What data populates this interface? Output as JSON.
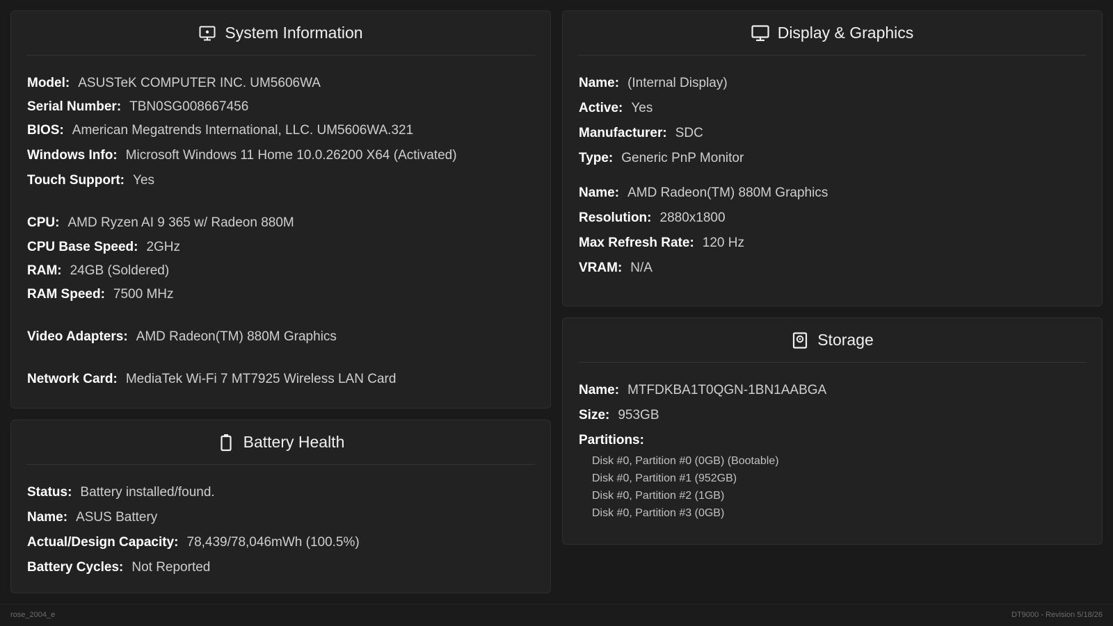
{
  "system": {
    "title": "System Information",
    "icon": "monitor-dot-icon",
    "rows": [
      {
        "key": "Model:",
        "value": "ASUSTeK COMPUTER INC. UM5606WA"
      },
      {
        "key": "Serial Number:",
        "value": "TBN0SG008667456"
      },
      {
        "key": "BIOS:",
        "value": "American Megatrends International, LLC. UM5606WA.321"
      },
      {
        "key": "Windows Info:",
        "value": "Microsoft Windows 11 Home 10.0.26200 X64 (Activated)"
      },
      {
        "key": "Touch Support:",
        "value": "Yes"
      },
      {
        "key": "CPU:",
        "value": "AMD Ryzen AI 9 365 w/ Radeon 880M"
      },
      {
        "key": "CPU Base Speed:",
        "value": "2GHz"
      },
      {
        "key": "RAM:",
        "value": "24GB (Soldered)"
      },
      {
        "key": "RAM Speed:",
        "value": "7500 MHz"
      },
      {
        "key": "Video Adapters:",
        "value": "AMD Radeon(TM) 880M Graphics"
      },
      {
        "key": "Network Card:",
        "value": "MediaTek Wi-Fi 7 MT7925 Wireless LAN Card"
      }
    ]
  },
  "battery": {
    "title": "Battery Health",
    "icon": "battery-icon",
    "rows": [
      {
        "key": "Status:",
        "value": "Battery installed/found."
      },
      {
        "key": "Name:",
        "value": "ASUS Battery"
      },
      {
        "key": "Actual/Design Capacity:",
        "value": "78,439/78,046mWh (100.5%)"
      },
      {
        "key": "Battery Cycles:",
        "value": "Not Reported"
      }
    ]
  },
  "display": {
    "title": "Display & Graphics",
    "icon": "monitor-icon",
    "rows": [
      {
        "key": "Name:",
        "value": "(Internal Display)"
      },
      {
        "key": "Active:",
        "value": "Yes"
      },
      {
        "key": "Manufacturer:",
        "value": "SDC"
      },
      {
        "key": "Type:",
        "value": "Generic PnP Monitor"
      },
      {
        "key": "Name:",
        "value": "AMD Radeon(TM) 880M Graphics"
      },
      {
        "key": "Resolution:",
        "value": "2880x1800"
      },
      {
        "key": "Max Refresh Rate:",
        "value": "120 Hz"
      },
      {
        "key": "VRAM:",
        "value": "N/A"
      }
    ]
  },
  "storage": {
    "title": "Storage",
    "icon": "hard-drive-icon",
    "rows": [
      {
        "key": "Name:",
        "value": "MTFDKBA1T0QGN-1BN1AABGA"
      },
      {
        "key": "Size:",
        "value": "953GB"
      }
    ],
    "partitions_label": "Partitions:",
    "partitions": [
      "Disk #0, Partition #0 (0GB) (Bootable)",
      "Disk #0, Partition #1 (952GB)",
      "Disk #0, Partition #2 (1GB)",
      "Disk #0, Partition #3 (0GB)"
    ]
  },
  "footer": {
    "left": "rose_2004_e",
    "right": "DT9000 - Revision 5/18/26"
  }
}
